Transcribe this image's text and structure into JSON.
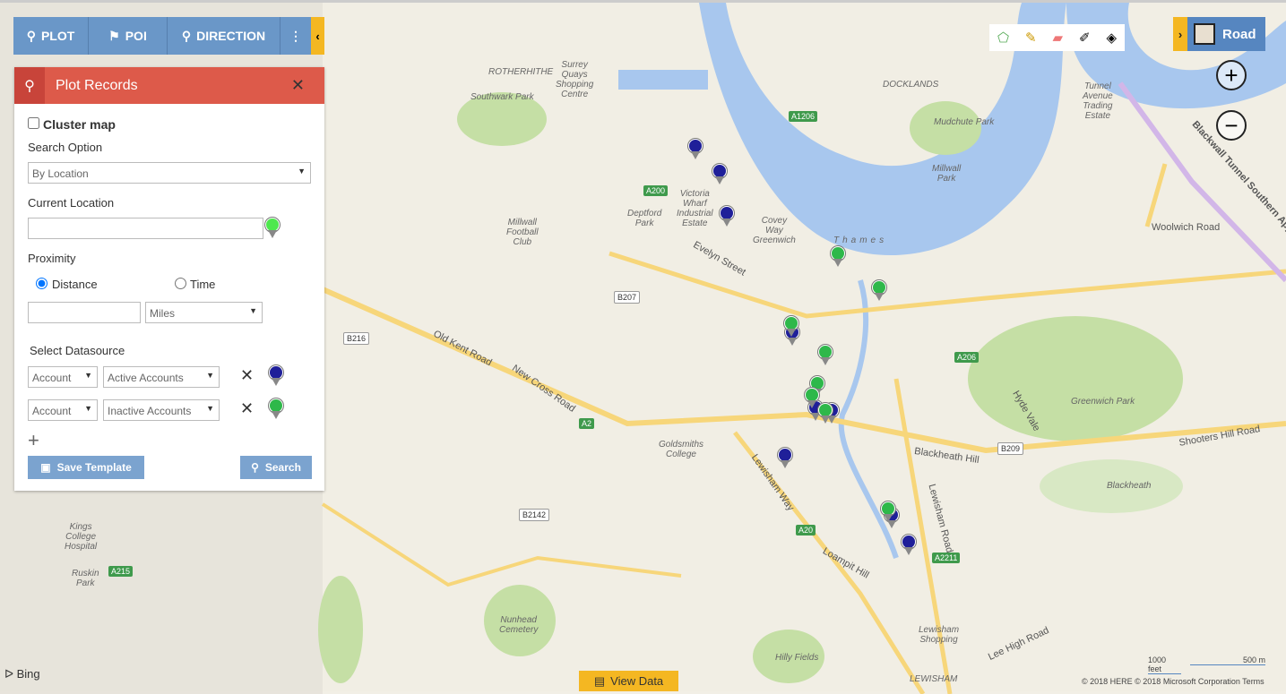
{
  "toolbar": {
    "plot": "PLOT",
    "poi": "POI",
    "direction": "DIRECTION",
    "more": "⋮",
    "collapse": "‹"
  },
  "panel": {
    "title": "Plot Records",
    "close": "✕",
    "cluster_map": "Cluster map",
    "search_option_label": "Search Option",
    "search_option_value": "By Location",
    "current_location_label": "Current Location",
    "current_location_value": "",
    "proximity_label": "Proximity",
    "distance": "Distance",
    "time": "Time",
    "distance_value": "",
    "unit": "Miles",
    "select_datasource": "Select Datasource",
    "datasources": [
      {
        "entity": "Account",
        "view": "Active Accounts",
        "pin_color": "#1f1f99"
      },
      {
        "entity": "Account",
        "view": "Inactive Accounts",
        "pin_color": "#2eb84a"
      }
    ],
    "add": "+",
    "save_template": "Save Template",
    "search": "Search"
  },
  "map_type": {
    "label": "Road",
    "expand": "›"
  },
  "zoom": {
    "in": "+",
    "out": "−"
  },
  "view_data": "View Data",
  "bing": "Bing",
  "scale": {
    "feet": "1000 feet",
    "meters": "500 m"
  },
  "copyright": "© 2018 HERE © 2018 Microsoft Corporation  Terms",
  "colors": {
    "accent": "#dd5a4a",
    "toolbar": "#6a97c8",
    "yellow": "#f4b722",
    "active_pin": "#1f1f99",
    "inactive_pin": "#2eb84a",
    "water": "#a8c7ee",
    "park": "#c5dfa5"
  },
  "map": {
    "labels": [
      "ROTHERHITHE",
      "Surrey\nQuays\nShopping\nCentre",
      "Southwark Park",
      "DOCKLANDS",
      "Mudchute Park",
      "Millwall\nPark",
      "Thames",
      "Deptford\nPark",
      "Millwall\nFootball\nClub",
      "Goldsmiths\nCollege",
      "Greenwich Park",
      "Blackheath",
      "Nunhead\nCemetery",
      "Hilly Fields",
      "LEWISHAM",
      "Lewisham\nShopping",
      "Kings\nCollege\nHospital",
      "Ruskin\nPark",
      "Victoria\nWharf\nIndustrial\nEstate",
      "Covey\nWay\nGreenwich",
      "Tunnel\nAvenue\nTrading\nEstate"
    ],
    "roads": [
      "Old Kent Road",
      "New Cross Road",
      "Evelyn Street",
      "Lewisham Way",
      "Loampit Hill",
      "Blackheath Hill",
      "Shooters Hill Road",
      "Lewisham Road",
      "Woolwich Road",
      "Lee High Road",
      "Blackwall Tunnel Southern Approach",
      "Hyde Vale"
    ],
    "shields": [
      "A200",
      "A2",
      "A20",
      "A206",
      "A2211",
      "A215",
      "B216",
      "B207",
      "B2142",
      "A1206",
      "B209"
    ]
  }
}
